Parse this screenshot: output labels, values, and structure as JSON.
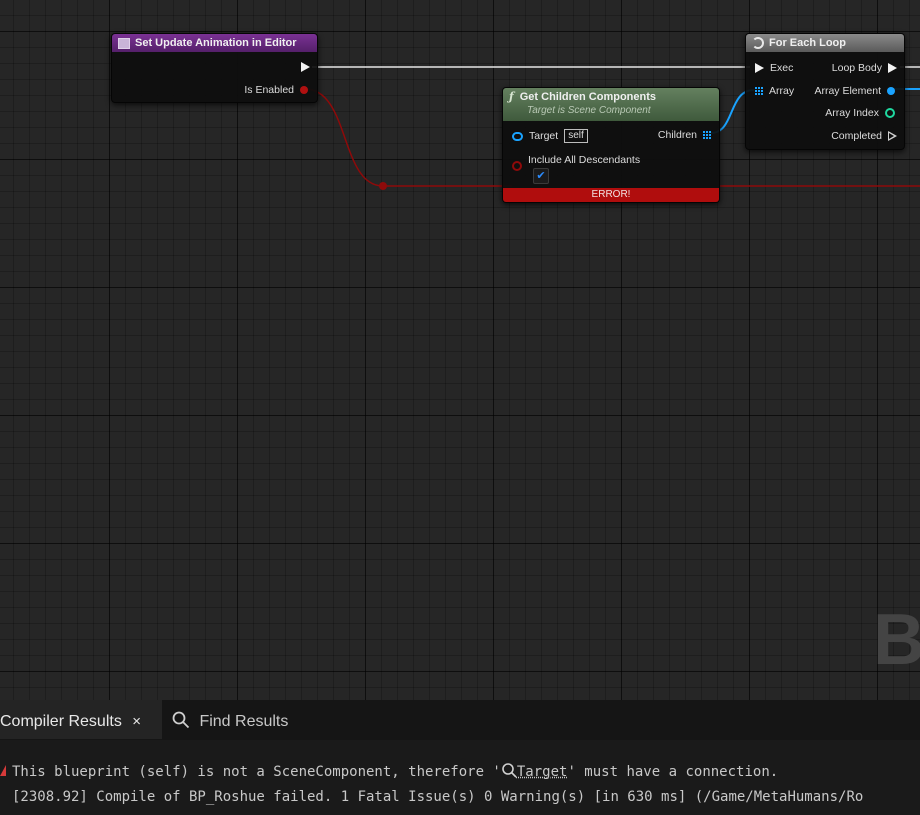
{
  "nodes": {
    "set_update": {
      "title": "Set Update Animation in Editor",
      "pin_is_enabled": "Is Enabled"
    },
    "get_children": {
      "title": "Get Children Components",
      "subtitle": "Target is Scene Component",
      "pin_target": "Target",
      "target_default": "self",
      "pin_include": "Include All Descendants",
      "pin_children": "Children",
      "error_label": "ERROR!"
    },
    "for_each": {
      "title": "For Each Loop",
      "pin_exec": "Exec",
      "pin_array": "Array",
      "pin_loop_body": "Loop Body",
      "pin_array_element": "Array Element",
      "pin_array_index": "Array Index",
      "pin_completed": "Completed"
    }
  },
  "watermark": "B",
  "panel": {
    "tabs": [
      {
        "label": "Compiler Results",
        "close": "×"
      },
      {
        "label": "Find Results"
      }
    ],
    "messages": {
      "error_prefix": "This blueprint (self) is not a SceneComponent, therefore '",
      "error_link": "Target",
      "error_suffix": "' must have a connection.",
      "log_line": "[2308.92] Compile of BP_Roshue failed. 1 Fatal Issue(s) 0 Warning(s) [in 630 ms] (/Game/MetaHumans/Ro"
    }
  },
  "colors": {
    "exec_wire": "#e6e6e6",
    "bool_wire": "#8e0a0a",
    "object_wire": "#1aa3ff",
    "error_bar": "#b00d0d",
    "function_header": "#4e6b4a",
    "event_header": "#6b2a82"
  }
}
